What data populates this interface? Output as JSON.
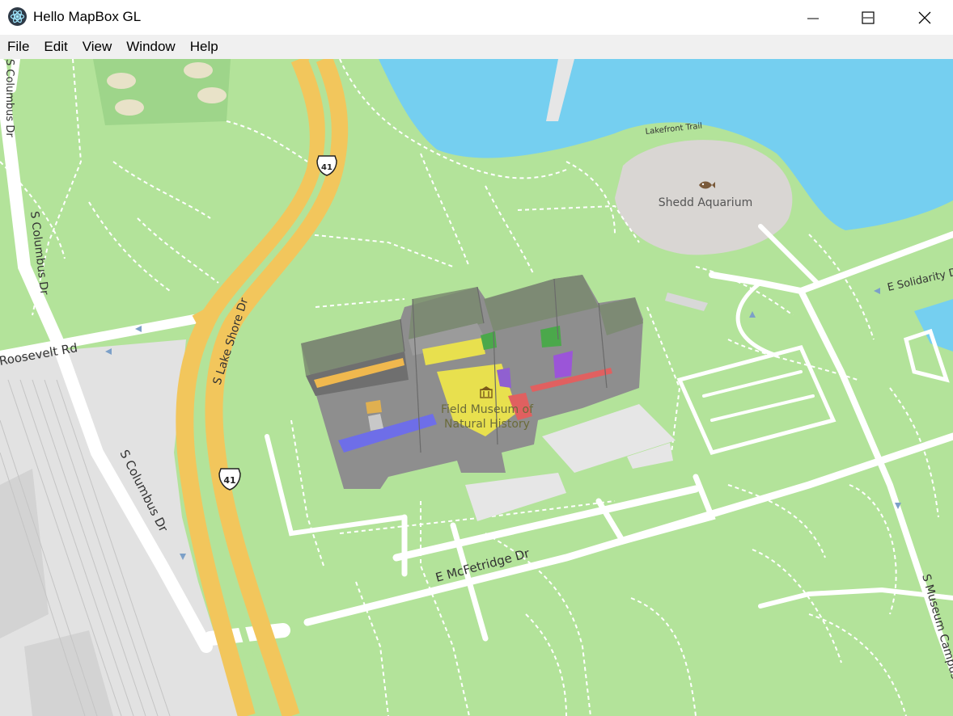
{
  "window": {
    "title": "Hello MapBox GL",
    "icon": "electron-atom-icon",
    "controls": [
      "minimize",
      "maximize",
      "close"
    ]
  },
  "menu": {
    "items": [
      "File",
      "Edit",
      "View",
      "Window",
      "Help"
    ]
  },
  "map": {
    "pois": {
      "aquarium": "Shedd Aquarium",
      "museum_line1": "Field Museum of",
      "museum_line2": "Natural History"
    },
    "roads": {
      "columbus_top": "S Columbus Dr",
      "columbus_left": "S Columbus Dr",
      "columbus_bottom": "S Columbus Dr",
      "roosevelt": "Roosevelt Rd",
      "lake_shore": "S Lake Shore Dr",
      "mcfetridge": "E McFetridge Dr",
      "solidarity": "E Solidarity D",
      "museum_campus": "S Museum Campus D",
      "lakefront_trail": "Lakefront Trail"
    },
    "shields": [
      "41",
      "41"
    ],
    "colors": {
      "park": "#b3e39a",
      "water": "#75cff0",
      "highway": "#f2c65c",
      "urban": "#e6e6e6",
      "aquarium_ground": "#d9d6d3"
    }
  }
}
